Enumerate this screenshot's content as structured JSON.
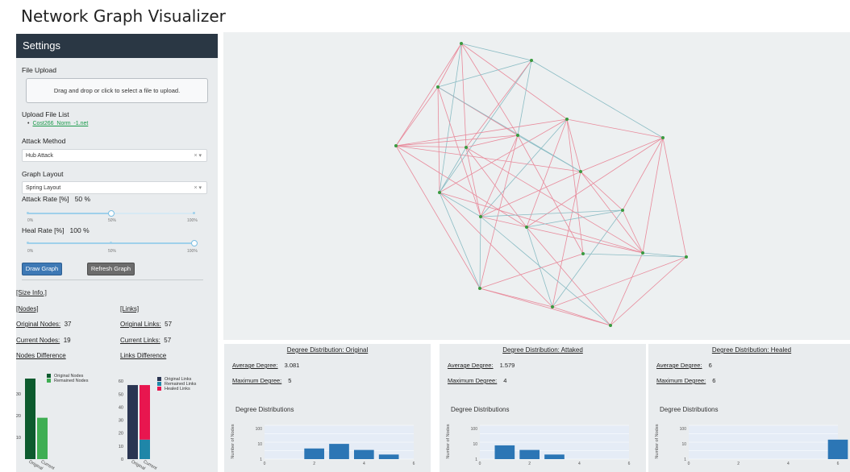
{
  "app": {
    "title": "Network Graph Visualizer"
  },
  "sidebar": {
    "header": "Settings",
    "file_upload_label": "File Upload",
    "upload_text": "Drag and drop or click to select a file to upload.",
    "file_list_label": "Upload File List",
    "files": [
      "Cost266_Norm_-1.net"
    ],
    "attack_method_label": "Attack Method",
    "attack_method_value": "Hub Attack",
    "graph_layout_label": "Graph Layout",
    "graph_layout_value": "Spring Layout",
    "clear_glyph": "×",
    "caret_glyph": "▾",
    "attack_rate_label": "Attack Rate [%]",
    "attack_rate_value": "50 %",
    "attack_rate": 50,
    "heal_rate_label": "Heal Rate [%]",
    "heal_rate_value": "100 %",
    "heal_rate": 100,
    "slider_ticks": [
      "0%",
      "50%",
      "100%"
    ],
    "draw_button": "Draw Graph",
    "refresh_button": "Refresh Graph",
    "size_info_label": "[Size Info.]",
    "nodes_label": "[Nodes]",
    "links_label": "[Links]",
    "original_nodes_label": "Original Nodes:",
    "original_nodes": "37",
    "current_nodes_label": "Current Nodes:",
    "current_nodes": "19",
    "original_links_label": "Original Links:",
    "original_links": "57",
    "current_links_label": "Current Links:",
    "current_links": "57",
    "nodes_diff_label": "Nodes Difference",
    "links_diff_label": "Links Difference"
  },
  "colors": {
    "original_nodes": "#0d5a2e",
    "remained_nodes": "#3fae53",
    "original_links": "#2a3552",
    "remained_links": "#1f86a8",
    "healed_links": "#e8164f",
    "edge_pink": "#e88a9b",
    "edge_teal": "#8bbcc4",
    "node": "#3a9a3f",
    "bar": "#2c76b5"
  },
  "chart_data": [
    {
      "type": "bar",
      "title": "Nodes Difference",
      "categories": [
        "Original",
        "Current"
      ],
      "series": [
        {
          "name": "Original Nodes",
          "values": [
            37,
            0
          ]
        },
        {
          "name": "Remained Nodes",
          "values": [
            0,
            19
          ]
        }
      ],
      "ylim": [
        0,
        37
      ],
      "yticks": [
        "10",
        "20",
        "30"
      ]
    },
    {
      "type": "bar",
      "title": "Links Difference",
      "stacked": true,
      "categories": [
        "Original",
        "Current"
      ],
      "series": [
        {
          "name": "Original Links",
          "values": [
            57,
            0
          ]
        },
        {
          "name": "Remained Links",
          "values": [
            0,
            15
          ]
        },
        {
          "name": "Healed Links",
          "values": [
            0,
            42
          ]
        }
      ],
      "ylim": [
        0,
        62
      ],
      "yticks": [
        "0",
        "10",
        "20",
        "30",
        "40",
        "50",
        "60"
      ]
    },
    {
      "type": "bar",
      "title": "Degree Distributions",
      "ylabel": "Number of Nodes",
      "xlabel": "Degree",
      "x": [
        2,
        3,
        4,
        5
      ],
      "values": [
        5,
        10,
        4,
        2
      ],
      "ylog": true,
      "xlim": [
        0,
        6
      ]
    },
    {
      "type": "bar",
      "title": "Degree Distributions",
      "ylabel": "Number of Nodes",
      "xlabel": "Degree",
      "x": [
        1,
        2,
        3
      ],
      "values": [
        8,
        4,
        2
      ],
      "ylog": true,
      "xlim": [
        0,
        6
      ]
    },
    {
      "type": "bar",
      "title": "Degree Distributions",
      "ylabel": "Number of Nodes",
      "xlabel": "Degree",
      "x": [
        6
      ],
      "values": [
        19
      ],
      "ylog": true,
      "xlim": [
        0,
        6
      ]
    }
  ],
  "panels": [
    {
      "title": "Degree Distribution: Original",
      "avg_label": "Average Degree:",
      "avg": "3.081",
      "max_label": "Maximum Degree:",
      "max": "5",
      "dist_label": "Degree Distributions",
      "y_axis": "Number of Nodes",
      "x_axis": "Degree"
    },
    {
      "title": "Degree Distribution: Attaked",
      "avg_label": "Average Degree:",
      "avg": "1.579",
      "max_label": "Maximum Degree:",
      "max": "4",
      "dist_label": "Degree Distributions",
      "y_axis": "Number of Nodes",
      "x_axis": "Degree"
    },
    {
      "title": "Degree Distribution: Healed",
      "avg_label": "Average Degree:",
      "avg": "6",
      "max_label": "Maximum Degree:",
      "max": "6",
      "dist_label": "Degree Distributions",
      "y_axis": "Number of Nodes",
      "x_axis": "Degree"
    }
  ],
  "mini_ticks": {
    "y": [
      "100",
      "10",
      "1"
    ],
    "x": [
      "0",
      "2",
      "4",
      "6"
    ]
  }
}
